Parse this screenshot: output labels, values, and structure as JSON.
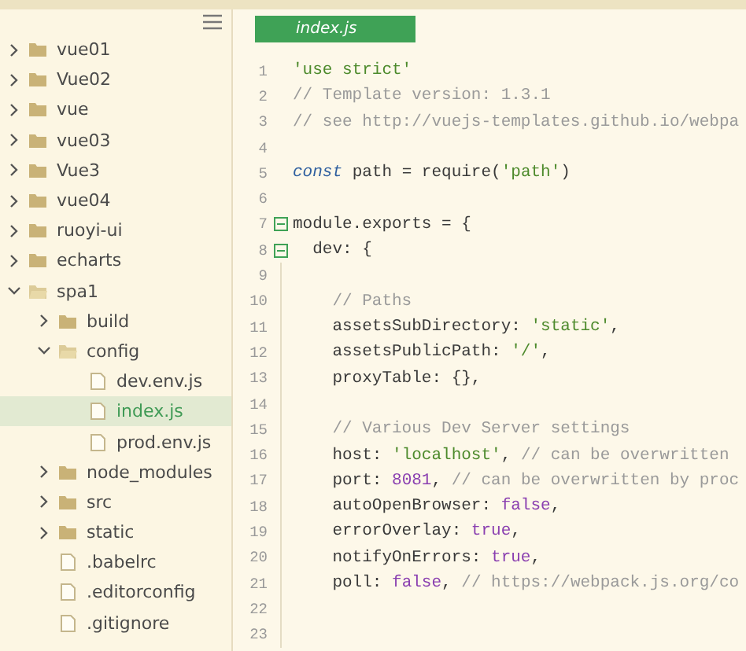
{
  "sidebar": {
    "items": [
      {
        "kind": "folder",
        "label": "vue01",
        "expanded": false,
        "selected": false
      },
      {
        "kind": "folder",
        "label": "Vue02",
        "expanded": false,
        "selected": false
      },
      {
        "kind": "folder",
        "label": "vue",
        "expanded": false,
        "selected": false
      },
      {
        "kind": "folder",
        "label": "vue03",
        "expanded": false,
        "selected": false
      },
      {
        "kind": "folder",
        "label": "Vue3",
        "expanded": false,
        "selected": false
      },
      {
        "kind": "folder",
        "label": "vue04",
        "expanded": false,
        "selected": false
      },
      {
        "kind": "folder",
        "label": "ruoyi-ui",
        "expanded": false,
        "selected": false
      },
      {
        "kind": "folder",
        "label": "echarts",
        "expanded": false,
        "selected": false
      },
      {
        "kind": "folder",
        "label": "spa1",
        "expanded": true,
        "selected": false,
        "children": [
          {
            "kind": "folder",
            "label": "build",
            "expanded": false,
            "selected": false
          },
          {
            "kind": "folder",
            "label": "config",
            "expanded": true,
            "selected": false,
            "children": [
              {
                "kind": "file",
                "label": "dev.env.js",
                "selected": false
              },
              {
                "kind": "file",
                "label": "index.js",
                "selected": true
              },
              {
                "kind": "file",
                "label": "prod.env.js",
                "selected": false
              }
            ]
          },
          {
            "kind": "folder",
            "label": "node_modules",
            "expanded": false,
            "selected": false
          },
          {
            "kind": "folder",
            "label": "src",
            "expanded": false,
            "selected": false
          },
          {
            "kind": "folder",
            "label": "static",
            "expanded": false,
            "selected": false
          },
          {
            "kind": "file",
            "label": ".babelrc",
            "selected": false
          },
          {
            "kind": "file",
            "label": ".editorconfig",
            "selected": false
          },
          {
            "kind": "file",
            "label": ".gitignore",
            "selected": false
          }
        ]
      }
    ]
  },
  "editor": {
    "tabs": [
      {
        "label": "index.js",
        "selected": true
      }
    ],
    "lines": [
      {
        "number": "1",
        "tokens": [
          {
            "kind": "string",
            "text": "'use strict'"
          }
        ]
      },
      {
        "number": "2",
        "tokens": [
          {
            "kind": "comment",
            "text": "// Template version: 1.3.1"
          }
        ]
      },
      {
        "number": "3",
        "tokens": [
          {
            "kind": "comment",
            "text": "// see http://vuejs-templates.github.io/webpa"
          }
        ]
      },
      {
        "number": "4"
      },
      {
        "number": "5",
        "tokens": [
          {
            "kind": "keyword",
            "text": "const"
          },
          {
            "kind": "plain",
            "text": " path = require("
          },
          {
            "kind": "string",
            "text": "'path'"
          },
          {
            "kind": "plain",
            "text": ")"
          }
        ]
      },
      {
        "number": "6"
      },
      {
        "number": "7",
        "fold": true,
        "tokens": [
          {
            "kind": "plain",
            "text": "module.exports = {"
          }
        ]
      },
      {
        "number": "8",
        "fold": true,
        "tokens": [
          {
            "kind": "plain",
            "text": "  dev: {"
          }
        ]
      },
      {
        "number": "9"
      },
      {
        "number": "10",
        "tokens": [
          {
            "kind": "comment",
            "text": "    // Paths"
          }
        ]
      },
      {
        "number": "11",
        "tokens": [
          {
            "kind": "plain",
            "text": "    assetsSubDirectory: "
          },
          {
            "kind": "string",
            "text": "'static'"
          },
          {
            "kind": "plain",
            "text": ","
          }
        ]
      },
      {
        "number": "12",
        "tokens": [
          {
            "kind": "plain",
            "text": "    assetsPublicPath: "
          },
          {
            "kind": "string",
            "text": "'/'"
          },
          {
            "kind": "plain",
            "text": ","
          }
        ]
      },
      {
        "number": "13",
        "tokens": [
          {
            "kind": "plain",
            "text": "    proxyTable: {},"
          }
        ]
      },
      {
        "number": "14"
      },
      {
        "number": "15",
        "tokens": [
          {
            "kind": "comment",
            "text": "    // Various Dev Server settings"
          }
        ]
      },
      {
        "number": "16",
        "tokens": [
          {
            "kind": "plain",
            "text": "    host: "
          },
          {
            "kind": "string",
            "text": "'localhost'"
          },
          {
            "kind": "plain",
            "text": ", "
          },
          {
            "kind": "comment",
            "text": "// can be overwritten"
          }
        ]
      },
      {
        "number": "17",
        "tokens": [
          {
            "kind": "plain",
            "text": "    port: "
          },
          {
            "kind": "number",
            "text": "8081"
          },
          {
            "kind": "plain",
            "text": ", "
          },
          {
            "kind": "comment",
            "text": "// can be overwritten by proc"
          }
        ]
      },
      {
        "number": "18",
        "tokens": [
          {
            "kind": "plain",
            "text": "    autoOpenBrowser: "
          },
          {
            "kind": "literal",
            "text": "false"
          },
          {
            "kind": "plain",
            "text": ","
          }
        ]
      },
      {
        "number": "19",
        "tokens": [
          {
            "kind": "plain",
            "text": "    errorOverlay: "
          },
          {
            "kind": "literal",
            "text": "true"
          },
          {
            "kind": "plain",
            "text": ","
          }
        ]
      },
      {
        "number": "20",
        "tokens": [
          {
            "kind": "plain",
            "text": "    notifyOnErrors: "
          },
          {
            "kind": "literal",
            "text": "true"
          },
          {
            "kind": "plain",
            "text": ","
          }
        ]
      },
      {
        "number": "21",
        "tokens": [
          {
            "kind": "plain",
            "text": "    poll: "
          },
          {
            "kind": "literal",
            "text": "false"
          },
          {
            "kind": "plain",
            "text": ", "
          },
          {
            "kind": "comment",
            "text": "// https://webpack.js.org/co"
          }
        ]
      },
      {
        "number": "22"
      },
      {
        "number": "23"
      }
    ]
  }
}
